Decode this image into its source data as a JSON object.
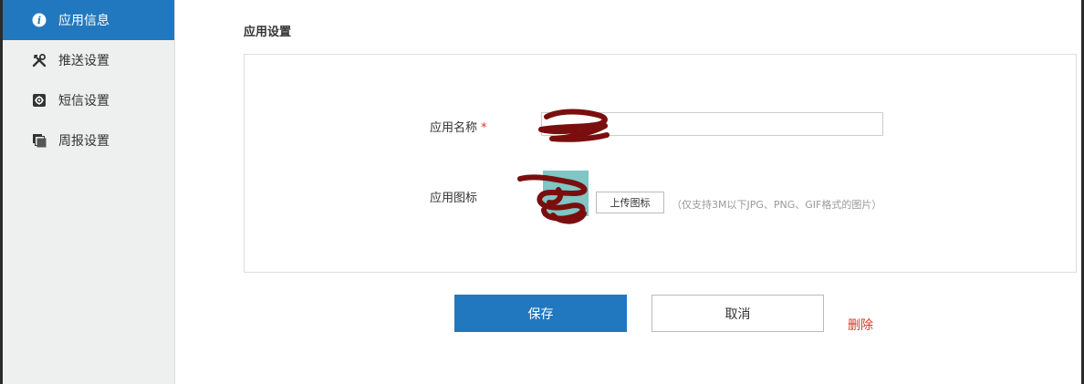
{
  "sidebar": {
    "items": [
      {
        "label": "应用信息",
        "icon": "info-icon",
        "active": true
      },
      {
        "label": "推送设置",
        "icon": "tools-icon",
        "active": false
      },
      {
        "label": "短信设置",
        "icon": "gear-icon",
        "active": false
      },
      {
        "label": "周报设置",
        "icon": "stack-icon",
        "active": false
      }
    ]
  },
  "main": {
    "section_title": "应用设置",
    "form": {
      "app_name_label": "应用名称",
      "required_mark": "*",
      "app_name_value": "",
      "app_icon_label": "应用图标",
      "upload_button_label": "上传图标",
      "upload_hint": "（仅支持3M以下JPG、PNG、GIF格式的图片）"
    },
    "actions": {
      "save_label": "保存",
      "cancel_label": "取消",
      "delete_label": "删除"
    }
  },
  "colors": {
    "accent": "#2278be",
    "danger": "#d9372a",
    "sidebar_bg": "#eef0f0",
    "scribble": "#7a0e0e"
  }
}
